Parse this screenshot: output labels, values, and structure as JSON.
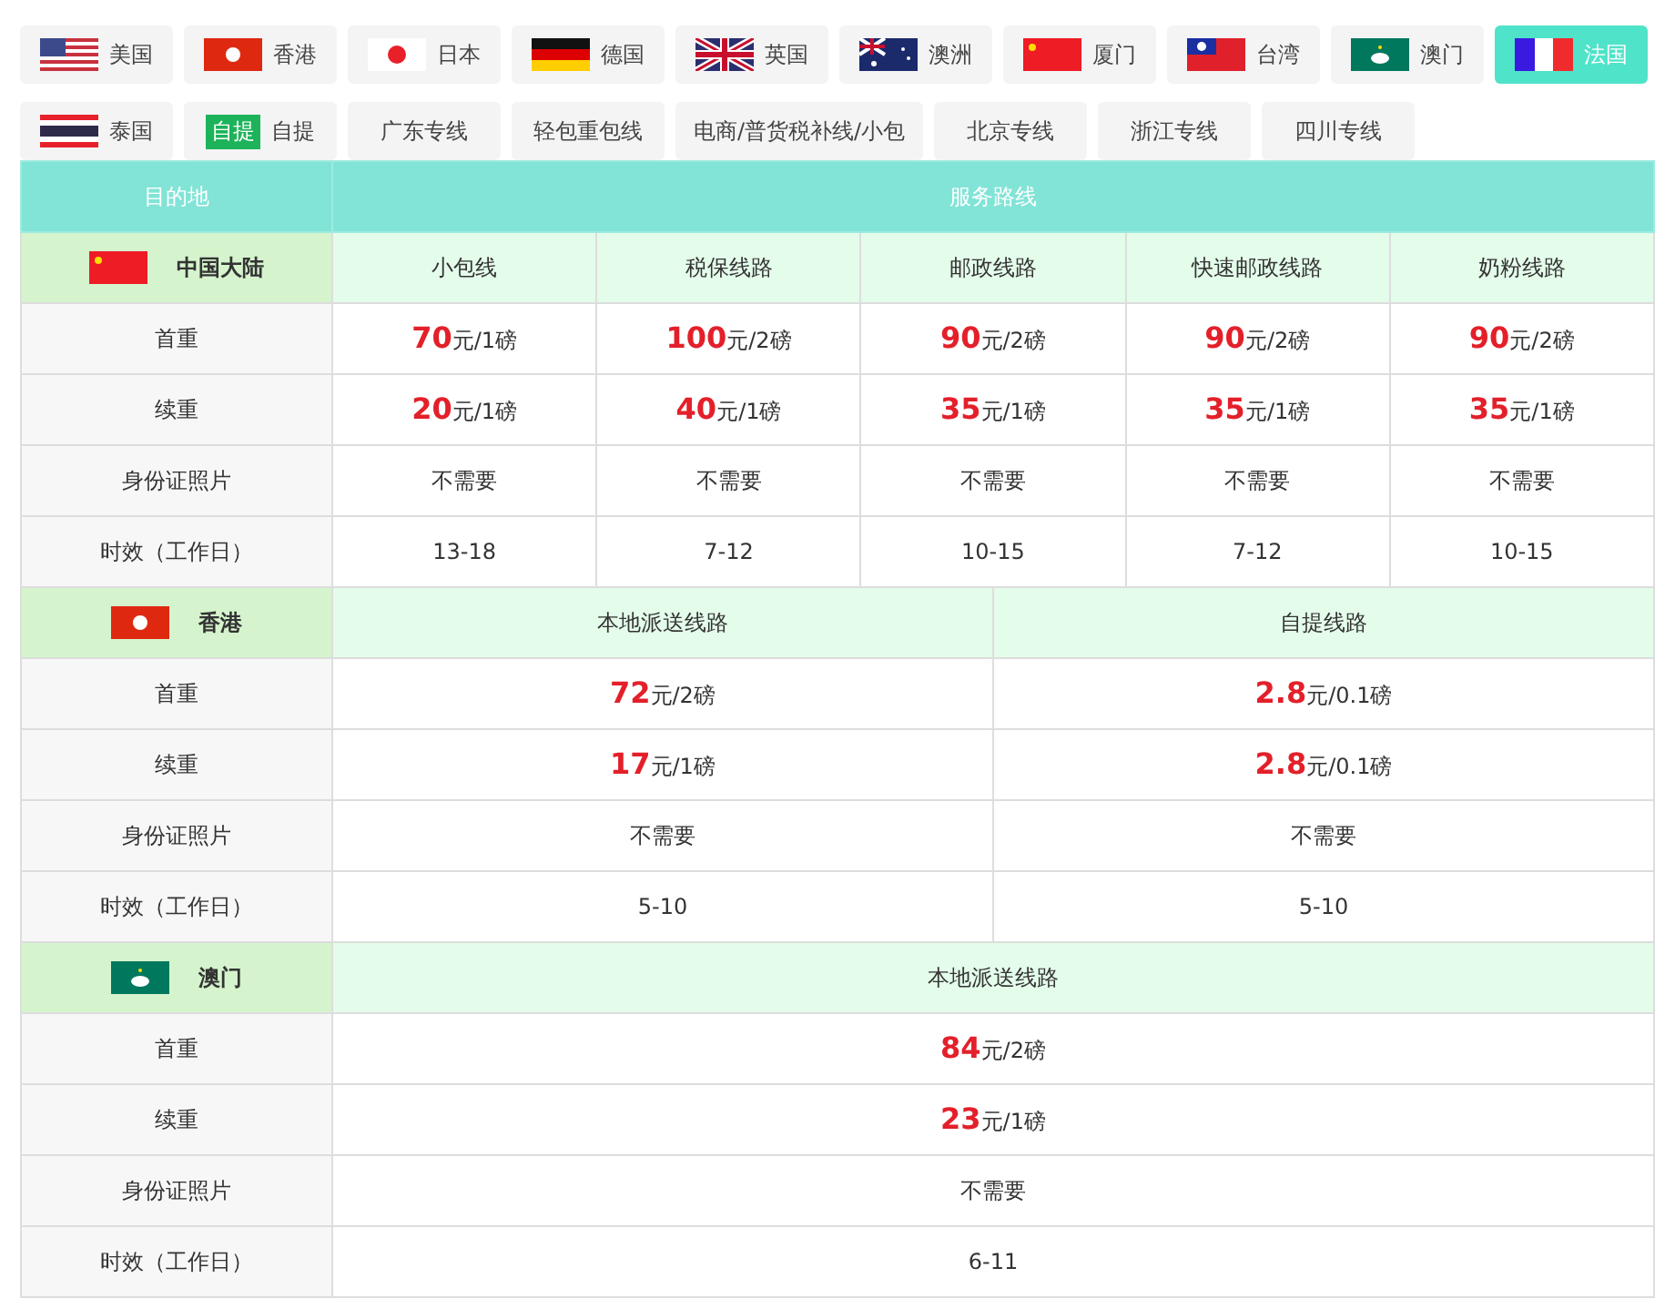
{
  "tab_rows": [
    [
      {
        "label": "美国",
        "kind": "us",
        "selected": false
      },
      {
        "label": "香港",
        "kind": "hk",
        "selected": false
      },
      {
        "label": "日本",
        "kind": "jp",
        "selected": false
      },
      {
        "label": "德国",
        "kind": "de",
        "selected": false
      },
      {
        "label": "英国",
        "kind": "gb",
        "selected": false
      },
      {
        "label": "澳洲",
        "kind": "au",
        "selected": false
      },
      {
        "label": "厦门",
        "kind": "cn",
        "selected": false
      },
      {
        "label": "台湾",
        "kind": "tw",
        "selected": false
      },
      {
        "label": "澳门",
        "kind": "mo",
        "selected": false
      },
      {
        "label": "法国",
        "kind": "fr",
        "selected": true
      }
    ],
    [
      {
        "label": "泰国",
        "kind": "th",
        "selected": false
      },
      {
        "label": "自提",
        "badge": "自提",
        "selected": false
      },
      {
        "label": "广东专线",
        "selected": false
      },
      {
        "label": "轻包重包线",
        "selected": false
      },
      {
        "label": "电商/普货税补线/小包",
        "selected": false
      },
      {
        "label": "北京专线",
        "selected": false
      },
      {
        "label": "浙江专线",
        "selected": false
      },
      {
        "label": "四川专线",
        "selected": false
      }
    ]
  ],
  "table": {
    "columns": [
      "目的地",
      "服务路线"
    ],
    "sections": [
      {
        "destination": "中国大陆",
        "kind": "cn",
        "routes": [
          "小包线",
          "税保线路",
          "邮政线路",
          "快速邮政线路",
          "奶粉线路"
        ],
        "rows": [
          {
            "label": "首重",
            "cells": [
              {
                "amount": "70",
                "unit": "元/1磅"
              },
              {
                "amount": "100",
                "unit": "元/2磅"
              },
              {
                "amount": "90",
                "unit": "元/2磅"
              },
              {
                "amount": "90",
                "unit": "元/2磅"
              },
              {
                "amount": "90",
                "unit": "元/2磅"
              }
            ]
          },
          {
            "label": "续重",
            "cells": [
              {
                "amount": "20",
                "unit": "元/1磅"
              },
              {
                "amount": "40",
                "unit": "元/1磅"
              },
              {
                "amount": "35",
                "unit": "元/1磅"
              },
              {
                "amount": "35",
                "unit": "元/1磅"
              },
              {
                "amount": "35",
                "unit": "元/1磅"
              }
            ]
          },
          {
            "label": "身份证照片",
            "cells": [
              {
                "text": "不需要"
              },
              {
                "text": "不需要"
              },
              {
                "text": "不需要"
              },
              {
                "text": "不需要"
              },
              {
                "text": "不需要"
              }
            ]
          },
          {
            "label": "时效（工作日）",
            "cells": [
              {
                "text": "13-18"
              },
              {
                "text": "7-12"
              },
              {
                "text": "10-15"
              },
              {
                "text": "7-12"
              },
              {
                "text": "10-15"
              }
            ]
          }
        ]
      },
      {
        "destination": "香港",
        "kind": "hk",
        "routes": [
          "本地派送线路",
          "自提线路"
        ],
        "rows": [
          {
            "label": "首重",
            "cells": [
              {
                "amount": "72",
                "unit": "元/2磅"
              },
              {
                "amount": "2.8",
                "unit": "元/0.1磅"
              }
            ]
          },
          {
            "label": "续重",
            "cells": [
              {
                "amount": "17",
                "unit": "元/1磅"
              },
              {
                "amount": "2.8",
                "unit": "元/0.1磅"
              }
            ]
          },
          {
            "label": "身份证照片",
            "cells": [
              {
                "text": "不需要"
              },
              {
                "text": "不需要"
              }
            ]
          },
          {
            "label": "时效（工作日）",
            "cells": [
              {
                "text": "5-10"
              },
              {
                "text": "5-10"
              }
            ]
          }
        ]
      },
      {
        "destination": "澳门",
        "kind": "mo",
        "routes": [
          "本地派送线路"
        ],
        "rows": [
          {
            "label": "首重",
            "cells": [
              {
                "amount": "84",
                "unit": "元/2磅"
              }
            ]
          },
          {
            "label": "续重",
            "cells": [
              {
                "amount": "23",
                "unit": "元/1磅"
              }
            ]
          },
          {
            "label": "身份证照片",
            "cells": [
              {
                "text": "不需要"
              }
            ]
          },
          {
            "label": "时效（工作日）",
            "cells": [
              {
                "text": "6-11"
              }
            ]
          }
        ]
      }
    ]
  }
}
